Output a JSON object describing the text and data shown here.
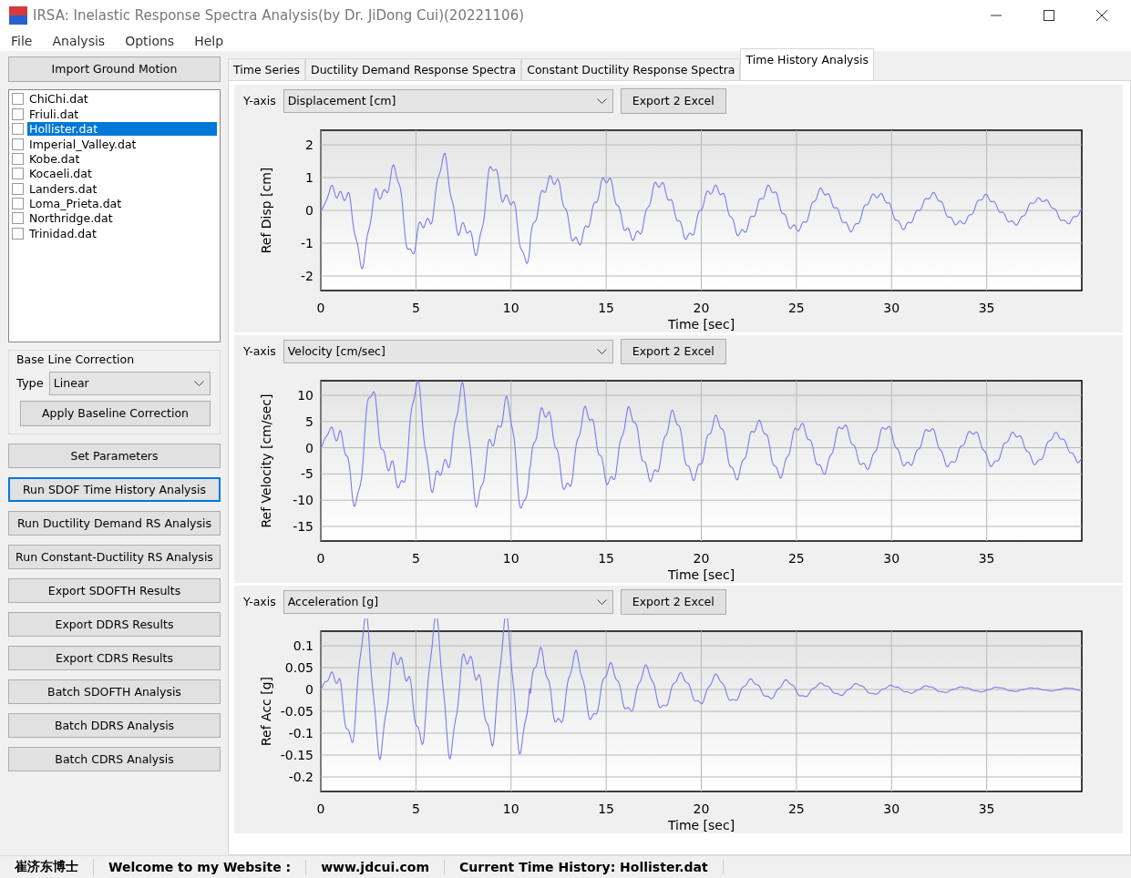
{
  "window": {
    "title": "IRSA: Inelastic Response Spectra Analysis(by Dr. JiDong Cui)(20221106)"
  },
  "menu": [
    "File",
    "Analysis",
    "Options",
    "Help"
  ],
  "sidebar": {
    "import_button": "Import Ground Motion",
    "files": [
      {
        "label": "ChiChi.dat",
        "checked": false,
        "selected": false
      },
      {
        "label": "Friuli.dat",
        "checked": false,
        "selected": false
      },
      {
        "label": "Hollister.dat",
        "checked": false,
        "selected": true
      },
      {
        "label": "Imperial_Valley.dat",
        "checked": false,
        "selected": false
      },
      {
        "label": "Kobe.dat",
        "checked": false,
        "selected": false
      },
      {
        "label": "Kocaeli.dat",
        "checked": false,
        "selected": false
      },
      {
        "label": "Landers.dat",
        "checked": false,
        "selected": false
      },
      {
        "label": "Loma_Prieta.dat",
        "checked": false,
        "selected": false
      },
      {
        "label": "Northridge.dat",
        "checked": false,
        "selected": false
      },
      {
        "label": "Trinidad.dat",
        "checked": false,
        "selected": false
      }
    ],
    "baseline": {
      "title": "Base Line Correction",
      "type_label": "Type",
      "type_value": "Linear",
      "apply_button": "Apply Baseline Correction"
    },
    "buttons": [
      {
        "label": "Set Parameters",
        "focused": false
      },
      {
        "label": "Run SDOF Time History Analysis",
        "focused": true
      },
      {
        "label": "Run Ductility Demand RS Analysis",
        "focused": false
      },
      {
        "label": "Run Constant-Ductility RS Analysis",
        "focused": false
      },
      {
        "label": "Export SDOFTH Results",
        "focused": false
      },
      {
        "label": "Export DDRS Results",
        "focused": false
      },
      {
        "label": "Export CDRS Results",
        "focused": false
      },
      {
        "label": "Batch SDOFTH Analysis",
        "focused": false
      },
      {
        "label": "Batch DDRS Analysis",
        "focused": false
      },
      {
        "label": "Batch CDRS Analysis",
        "focused": false
      }
    ]
  },
  "tabs": [
    {
      "label": "Time Series",
      "selected": false
    },
    {
      "label": "Ductility Demand Response Spectra",
      "selected": false
    },
    {
      "label": "Constant Ductility Response Spectra",
      "selected": false
    },
    {
      "label": "Time History Analysis",
      "selected": true
    }
  ],
  "panels": [
    {
      "yaxis_label": "Y-axis",
      "yaxis_value": "Displacement [cm]",
      "export_button": "Export 2 Excel",
      "ylabel": "Ref Disp  [cm]",
      "xlabel": "Time [sec]",
      "yticks": [
        "2",
        "1",
        "0",
        "-1",
        "-2"
      ],
      "xticks": [
        "0",
        "5",
        "10",
        "15",
        "20",
        "25",
        "30",
        "35"
      ]
    },
    {
      "yaxis_label": "Y-axis",
      "yaxis_value": "Velocity [cm/sec]",
      "export_button": "Export 2 Excel",
      "ylabel": "Ref Velocity  [cm/sec]",
      "xlabel": "Time [sec]",
      "yticks": [
        "10",
        "5",
        "0",
        "-5",
        "-10",
        "-15"
      ],
      "xticks": [
        "0",
        "5",
        "10",
        "15",
        "20",
        "25",
        "30",
        "35"
      ]
    },
    {
      "yaxis_label": "Y-axis",
      "yaxis_value": "Acceleration  [g]",
      "export_button": "Export 2 Excel",
      "ylabel": "Ref Acc [g]",
      "xlabel": "Time [sec]",
      "yticks": [
        "0.1",
        "0.05",
        "0",
        "-0.05",
        "-0.1",
        "-0.15",
        "-0.2"
      ],
      "xticks": [
        "0",
        "5",
        "10",
        "15",
        "20",
        "25",
        "30",
        "35"
      ]
    }
  ],
  "status_bar": [
    "崔济东博士",
    "Welcome to my Website :",
    "www.jdcui.com",
    "Current Time History: Hollister.dat"
  ]
}
